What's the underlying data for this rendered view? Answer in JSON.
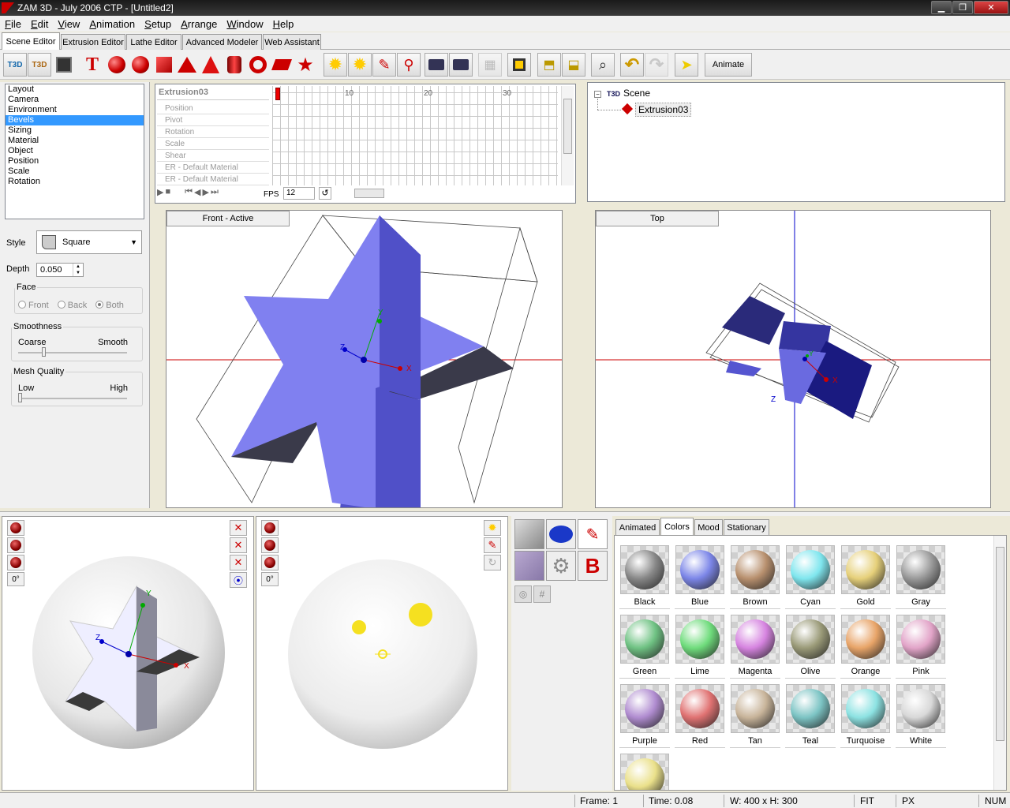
{
  "window": {
    "title": "ZAM 3D - July 2006 CTP - [Untitled2]"
  },
  "menu": [
    "File",
    "Edit",
    "View",
    "Animation",
    "Setup",
    "Arrange",
    "Window",
    "Help"
  ],
  "editor_tabs": [
    "Scene Editor",
    "Extrusion Editor",
    "Lathe Editor",
    "Advanced Modeler",
    "Web Assistant"
  ],
  "toolbar": {
    "animate_label": "Animate",
    "t3d_label": "T3D"
  },
  "property_list": [
    "Layout",
    "Camera",
    "Environment",
    "Bevels",
    "Sizing",
    "Material",
    "Object",
    "Position",
    "Scale",
    "Rotation"
  ],
  "property_selected": "Bevels",
  "bevel": {
    "style_label": "Style",
    "style_value": "Square",
    "depth_label": "Depth",
    "depth_value": "0.050",
    "face_label": "Face",
    "face_front": "Front",
    "face_back": "Back",
    "face_both": "Both",
    "smoothness_label": "Smoothness",
    "smooth_coarse": "Coarse",
    "smooth_smooth": "Smooth",
    "mesh_label": "Mesh Quality",
    "mesh_low": "Low",
    "mesh_high": "High"
  },
  "timeline": {
    "object_name": "Extrusion03",
    "tracks": [
      "Position",
      "Pivot",
      "Rotation",
      "Scale",
      "Shear",
      "ER - Default Material",
      "ER - Default Material"
    ],
    "ticks": [
      "10",
      "20",
      "30"
    ],
    "fps_label": "FPS",
    "fps_value": "12"
  },
  "scene_tree": {
    "root": "Scene",
    "child": "Extrusion03"
  },
  "viewports": {
    "front": "Front - Active",
    "top": "Top"
  },
  "axes": {
    "x": "X",
    "y": "Y",
    "z": "Z"
  },
  "rotation_degrees": "0°",
  "material_tabs": [
    "Animated",
    "Colors",
    "Mood",
    "Stationary"
  ],
  "material_active_tab": "Colors",
  "swatches": [
    {
      "name": "Black",
      "color": "#888888"
    },
    {
      "name": "Blue",
      "color": "#7c86e8"
    },
    {
      "name": "Brown",
      "color": "#b8906e"
    },
    {
      "name": "Cyan",
      "color": "#7fe6ee"
    },
    {
      "name": "Gold",
      "color": "#e6d07a"
    },
    {
      "name": "Gray",
      "color": "#9a9a9a"
    },
    {
      "name": "Green",
      "color": "#6fc283"
    },
    {
      "name": "Lime",
      "color": "#6fdc7c"
    },
    {
      "name": "Magenta",
      "color": "#d684e0"
    },
    {
      "name": "Olive",
      "color": "#9a9a78"
    },
    {
      "name": "Orange",
      "color": "#e8a468"
    },
    {
      "name": "Pink",
      "color": "#e2a4c8"
    },
    {
      "name": "Purple",
      "color": "#b08cd0"
    },
    {
      "name": "Red",
      "color": "#e07272"
    },
    {
      "name": "Tan",
      "color": "#c8b49a"
    },
    {
      "name": "Teal",
      "color": "#7cc4c4"
    },
    {
      "name": "Turquoise",
      "color": "#8ce2e2"
    },
    {
      "name": "White",
      "color": "#d8d8d8"
    },
    {
      "name": "",
      "color": "#eae08a"
    }
  ],
  "status": {
    "frame": "Frame: 1",
    "time": "Time: 0.08",
    "size": "W: 400 x H: 300",
    "fit": "FIT",
    "px": "PX",
    "num": "NUM"
  },
  "colors": {
    "accent_blue": "#3399ff",
    "star_face": "#8080f0",
    "star_side": "#5050c8",
    "axis_red": "#cc0000"
  }
}
